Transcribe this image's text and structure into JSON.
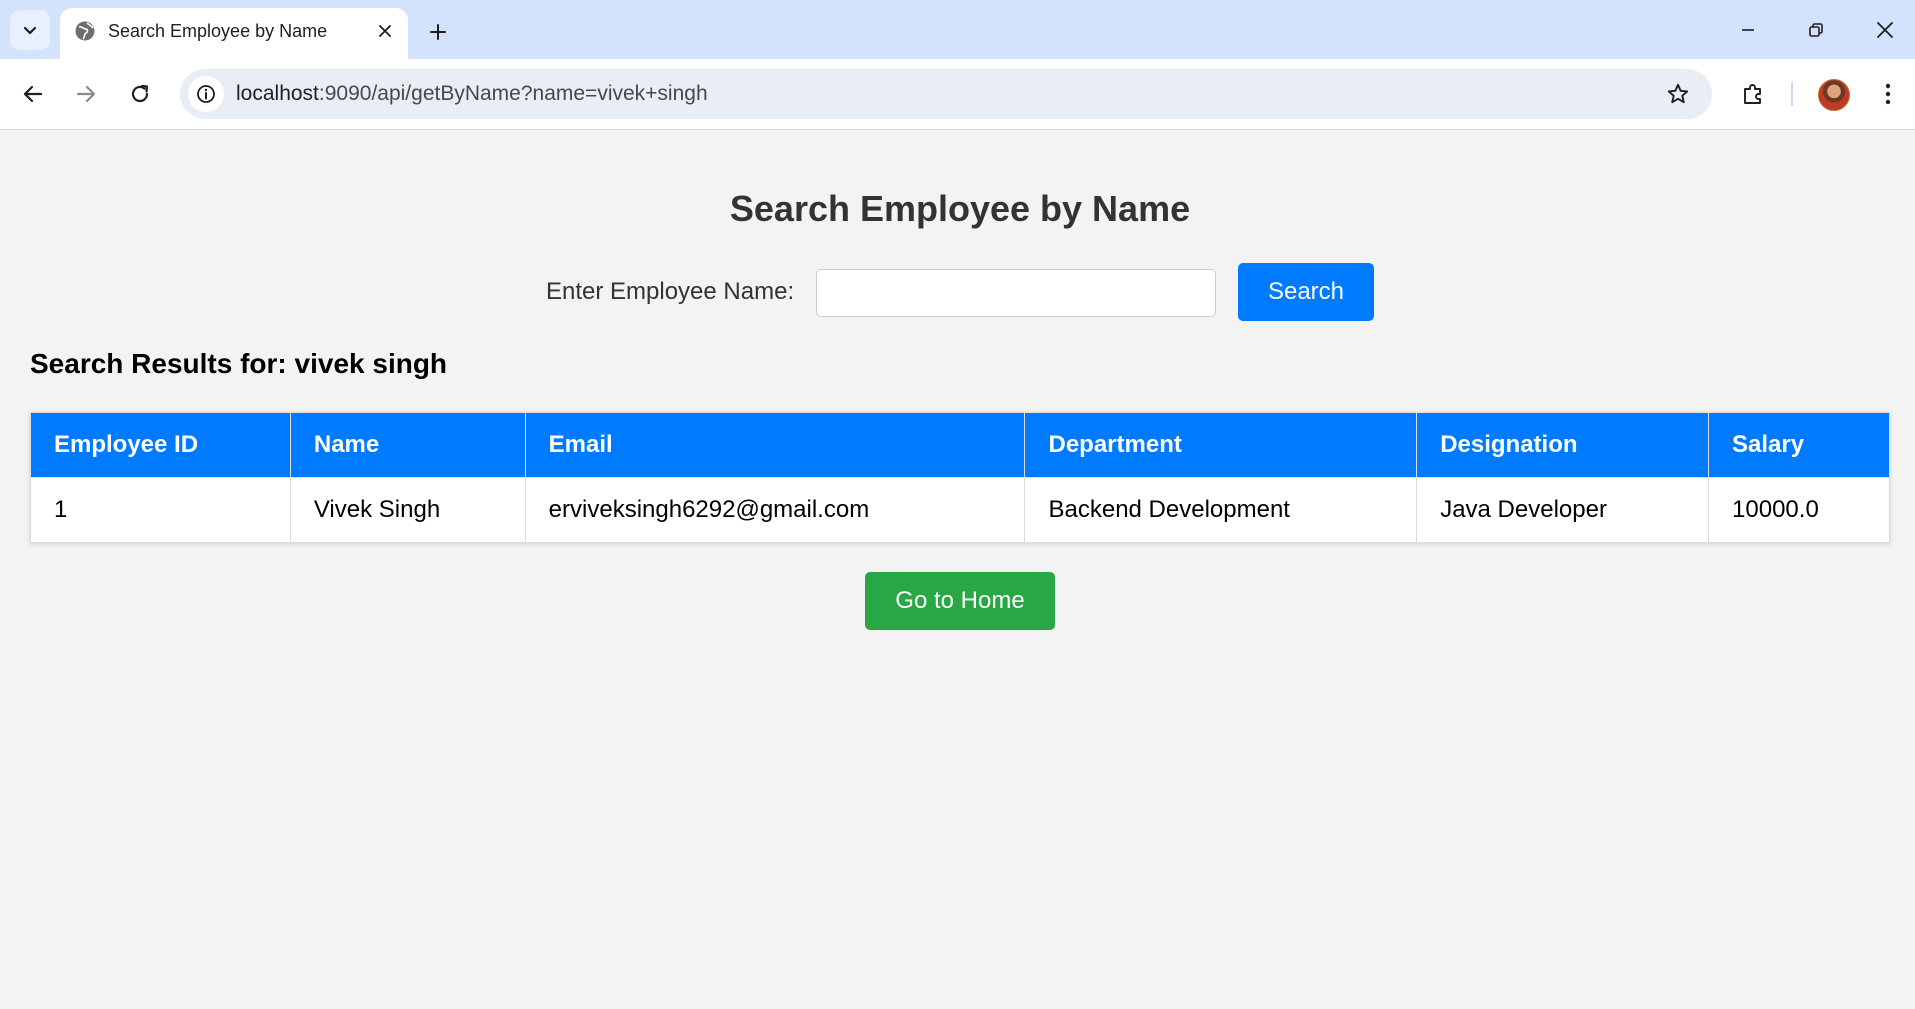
{
  "browser": {
    "tab": {
      "title": "Search Employee by Name"
    },
    "address": {
      "host": "localhost",
      "path": ":9090/api/getByName?name=vivek+singh"
    }
  },
  "page": {
    "title": "Search Employee by Name",
    "search": {
      "label": "Enter Employee Name:",
      "value": "",
      "button_label": "Search"
    },
    "results_heading": "Search Results for: vivek singh",
    "table": {
      "columns": [
        "Employee ID",
        "Name",
        "Email",
        "Department",
        "Designation",
        "Salary"
      ],
      "rows": [
        [
          "1",
          "Vivek Singh",
          "erviveksingh6292@gmail.com",
          "Backend Development",
          "Java Developer",
          "10000.0"
        ]
      ]
    },
    "home_button_label": "Go to Home"
  },
  "colors": {
    "primary": "#007bff",
    "success": "#28a745",
    "page_background": "#f3f3f3",
    "tabbar": "#d3e3fd"
  }
}
